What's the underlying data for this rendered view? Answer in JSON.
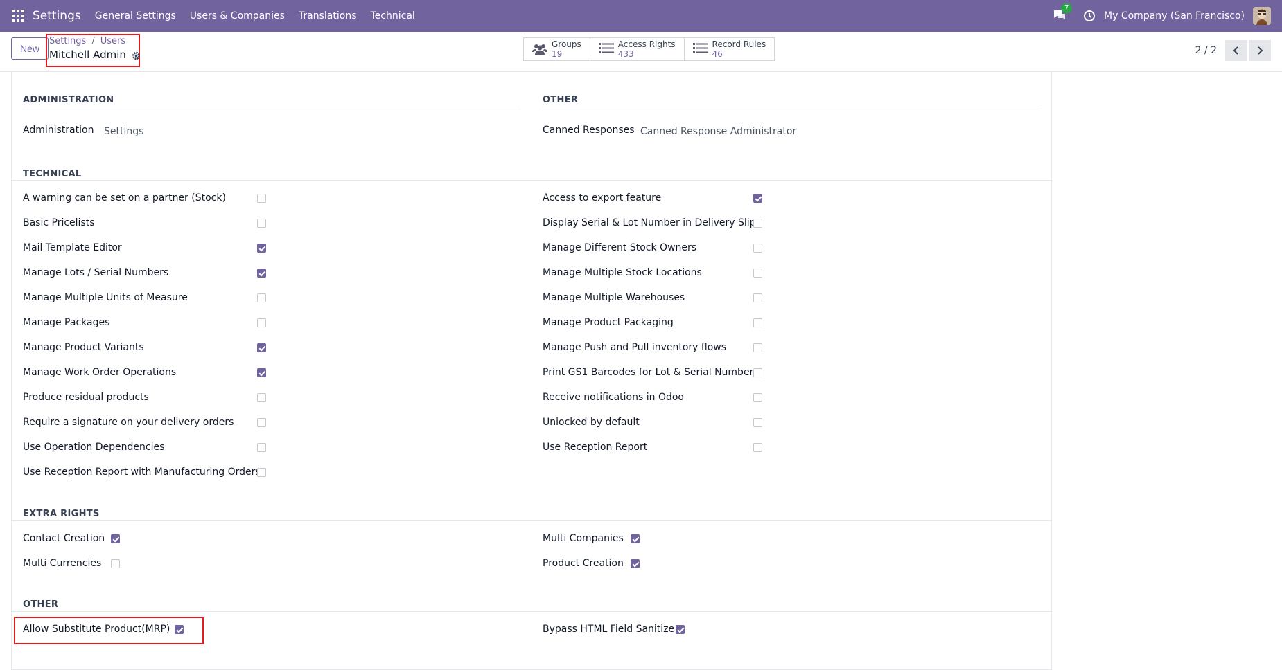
{
  "navbar": {
    "brand": "Settings",
    "menu": [
      "General Settings",
      "Users & Companies",
      "Translations",
      "Technical"
    ],
    "chat_badge": "7",
    "company": "My Company (San Francisco)"
  },
  "control": {
    "new_label": "New",
    "breadcrumb": [
      "Settings",
      "Users"
    ],
    "record_title": "Mitchell Admin",
    "smart_buttons": [
      {
        "label": "Groups",
        "value": "19"
      },
      {
        "label": "Access Rights",
        "value": "433"
      },
      {
        "label": "Record Rules",
        "value": "46"
      }
    ],
    "pager": "2 / 2"
  },
  "sections": {
    "administration": {
      "title": "ADMINISTRATION",
      "label": "Administration",
      "value": "Settings"
    },
    "other_top": {
      "title": "OTHER",
      "label": "Canned Responses",
      "value": "Canned Response Administrator"
    },
    "technical": {
      "title": "TECHNICAL",
      "left": [
        {
          "label": "A warning can be set on a partner (Stock)",
          "checked": false
        },
        {
          "label": "Basic Pricelists",
          "checked": false
        },
        {
          "label": "Mail Template Editor",
          "checked": true
        },
        {
          "label": "Manage Lots / Serial Numbers",
          "checked": true
        },
        {
          "label": "Manage Multiple Units of Measure",
          "checked": false
        },
        {
          "label": "Manage Packages",
          "checked": false
        },
        {
          "label": "Manage Product Variants",
          "checked": true
        },
        {
          "label": "Manage Work Order Operations",
          "checked": true
        },
        {
          "label": "Produce residual products",
          "checked": false
        },
        {
          "label": "Require a signature on your delivery orders",
          "checked": false
        },
        {
          "label": "Use Operation Dependencies",
          "checked": false
        },
        {
          "label": "Use Reception Report with Manufacturing Orders",
          "checked": false
        }
      ],
      "right": [
        {
          "label": "Access to export feature",
          "checked": true
        },
        {
          "label": "Display Serial & Lot Number in Delivery Slips",
          "checked": false
        },
        {
          "label": "Manage Different Stock Owners",
          "checked": false
        },
        {
          "label": "Manage Multiple Stock Locations",
          "checked": false
        },
        {
          "label": "Manage Multiple Warehouses",
          "checked": false
        },
        {
          "label": "Manage Product Packaging",
          "checked": false
        },
        {
          "label": "Manage Push and Pull inventory flows",
          "checked": false
        },
        {
          "label": "Print GS1 Barcodes for Lot & Serial Numbers",
          "checked": false
        },
        {
          "label": "Receive notifications in Odoo",
          "checked": false
        },
        {
          "label": "Unlocked by default",
          "checked": false
        },
        {
          "label": "Use Reception Report",
          "checked": false
        }
      ]
    },
    "extra_rights": {
      "title": "EXTRA RIGHTS",
      "left": [
        {
          "label": "Contact Creation",
          "checked": true
        },
        {
          "label": "Multi Currencies",
          "checked": false
        }
      ],
      "right": [
        {
          "label": "Multi Companies",
          "checked": true
        },
        {
          "label": "Product Creation",
          "checked": true
        }
      ]
    },
    "other_bottom": {
      "title": "OTHER",
      "left": [
        {
          "label": "Allow Substitute Product(MRP)",
          "checked": true
        }
      ],
      "right": [
        {
          "label": "Bypass HTML Field Sanitize",
          "checked": true
        }
      ]
    }
  },
  "colors": {
    "navbar": "#71639e",
    "accent": "#71639e",
    "highlight": "#e11d1d"
  }
}
